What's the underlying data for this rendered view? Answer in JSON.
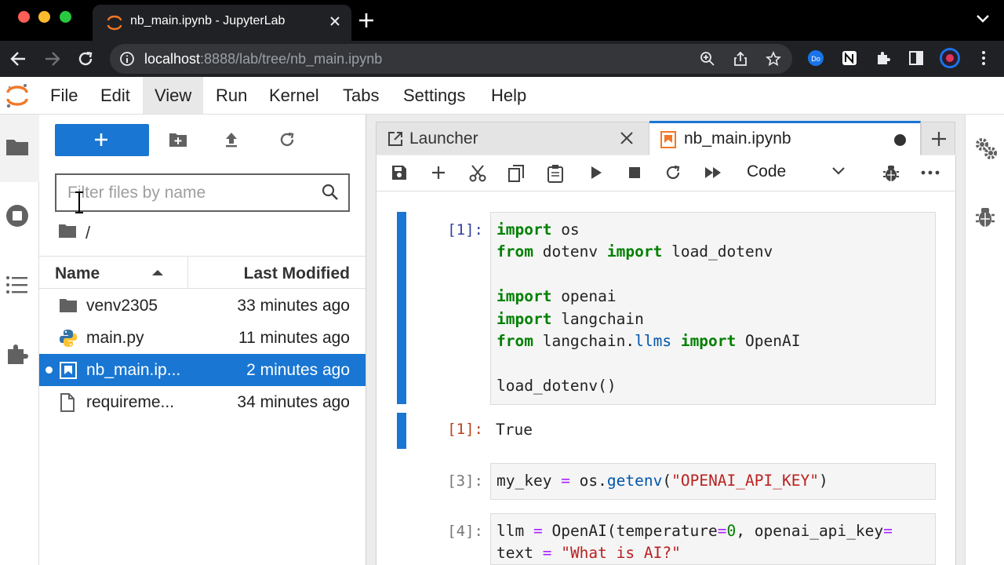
{
  "browser": {
    "tab_title": "nb_main.ipynb - JupyterLab",
    "url_host": "localhost",
    "url_rest": ":8888/lab/tree/nb_main.ipynb",
    "ext_badge": "Do"
  },
  "menu": {
    "items": [
      "File",
      "Edit",
      "View",
      "Run",
      "Kernel",
      "Tabs",
      "Settings",
      "Help"
    ],
    "active": "View"
  },
  "filebrowser": {
    "new_label": "+",
    "filter_placeholder": "Filter files by name",
    "filter_value": "",
    "breadcrumb": "/",
    "col_name": "Name",
    "col_modified": "Last Modified",
    "files": [
      {
        "name": "venv2305",
        "modified": "33 minutes ago",
        "icon": "folder-icon"
      },
      {
        "name": "main.py",
        "modified": "11 minutes ago",
        "icon": "python-icon"
      },
      {
        "name": "nb_main.ip...",
        "modified": "2 minutes ago",
        "icon": "notebook-icon",
        "selected": true
      },
      {
        "name": "requireme...",
        "modified": "34 minutes ago",
        "icon": "file-icon"
      }
    ]
  },
  "dock": {
    "launcher_tab": "Launcher",
    "notebook_tab": "nb_main.ipynb"
  },
  "toolbar": {
    "cell_type": "Code"
  },
  "cells": [
    {
      "prompt": "[1]:",
      "output_prompt": "[1]:",
      "output": "True"
    },
    {
      "prompt": "[3]:"
    },
    {
      "prompt": "[4]:"
    }
  ],
  "colors": {
    "accent": "#1976d2",
    "keyword": "#008000",
    "string": "#ba2121",
    "operator": "#aa22ff",
    "out_prompt": "#b7431a"
  }
}
